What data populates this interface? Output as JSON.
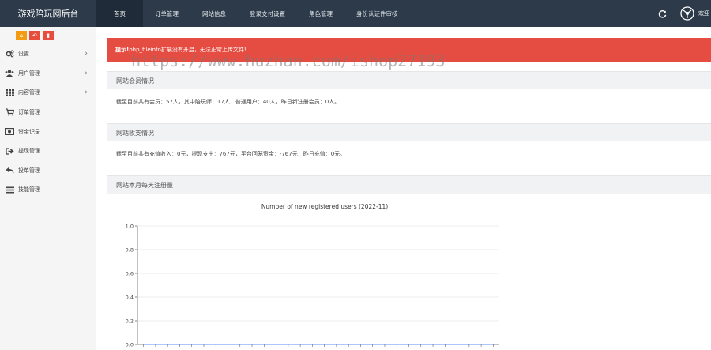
{
  "app": {
    "title": "游戏陪玩网后台"
  },
  "top_nav": [
    {
      "label": "首页",
      "active": true
    },
    {
      "label": "订单管理",
      "active": false
    },
    {
      "label": "网站信息",
      "active": false
    },
    {
      "label": "登录支付设置",
      "active": false
    },
    {
      "label": "角色管理",
      "active": false
    },
    {
      "label": "身份认证件审核",
      "active": false
    }
  ],
  "header_right": {
    "refresh_icon": "refresh-icon",
    "user_icon": "user-avatar-icon",
    "welcome_label": "欢迎"
  },
  "sidebar": {
    "tools": [
      {
        "icon": "home-icon",
        "color": "#f39c12"
      },
      {
        "icon": "back-icon",
        "color": "#e74c3c"
      },
      {
        "icon": "bookmark-icon",
        "color": "#e74c3c"
      }
    ],
    "items": [
      {
        "label": "设置",
        "icon": "cogs-icon",
        "has_arrow": true
      },
      {
        "label": "用户管理",
        "icon": "users-icon",
        "has_arrow": true
      },
      {
        "label": "内容管理",
        "icon": "grid-icon",
        "has_arrow": true
      },
      {
        "label": "订单管理",
        "icon": "cart-icon",
        "has_arrow": false
      },
      {
        "label": "资金记录",
        "icon": "money-icon",
        "has_arrow": false
      },
      {
        "label": "提现管理",
        "icon": "sign-out-icon",
        "has_arrow": false
      },
      {
        "label": "投单管理",
        "icon": "reply-icon",
        "has_arrow": false
      },
      {
        "label": "技能管理",
        "icon": "list-icon",
        "has_arrow": false
      }
    ]
  },
  "watermark": "https://www.huzhan.com/ishop27193",
  "alert": {
    "prefix": "提示!",
    "message": "php_fileinfo扩展没有开启，无法正常上传文件!",
    "color": "#e54d42"
  },
  "panels": {
    "members": {
      "title": "网站会员情况",
      "text": "截至目前共有会员：57人，其中陪玩师：17人，普通用户：40人，昨日新注册会员：0人。"
    },
    "finance": {
      "title": "网站收支情况",
      "text": "截至目前共有充值收入：0元，提现支出：767元，平台回笼资金：-767元，昨日充值：0元。"
    },
    "registrations": {
      "title": "网站本月每天注册量"
    }
  },
  "chart_data": {
    "type": "line",
    "title": "Number of new registered users (2022-11)",
    "xlabel": "",
    "ylabel": "",
    "ylim": [
      0,
      1.0
    ],
    "yticks": [
      "0.0",
      "0.2",
      "0.4",
      "0.6",
      "0.8",
      "1.0"
    ],
    "grid": true,
    "series": [
      {
        "values": [
          0,
          0,
          0,
          0,
          0,
          0,
          0,
          0,
          0,
          0,
          0,
          0,
          0,
          0,
          0,
          0,
          0,
          0,
          0,
          0,
          0,
          0,
          0,
          0,
          0,
          0,
          0,
          0,
          0,
          0
        ]
      }
    ]
  }
}
